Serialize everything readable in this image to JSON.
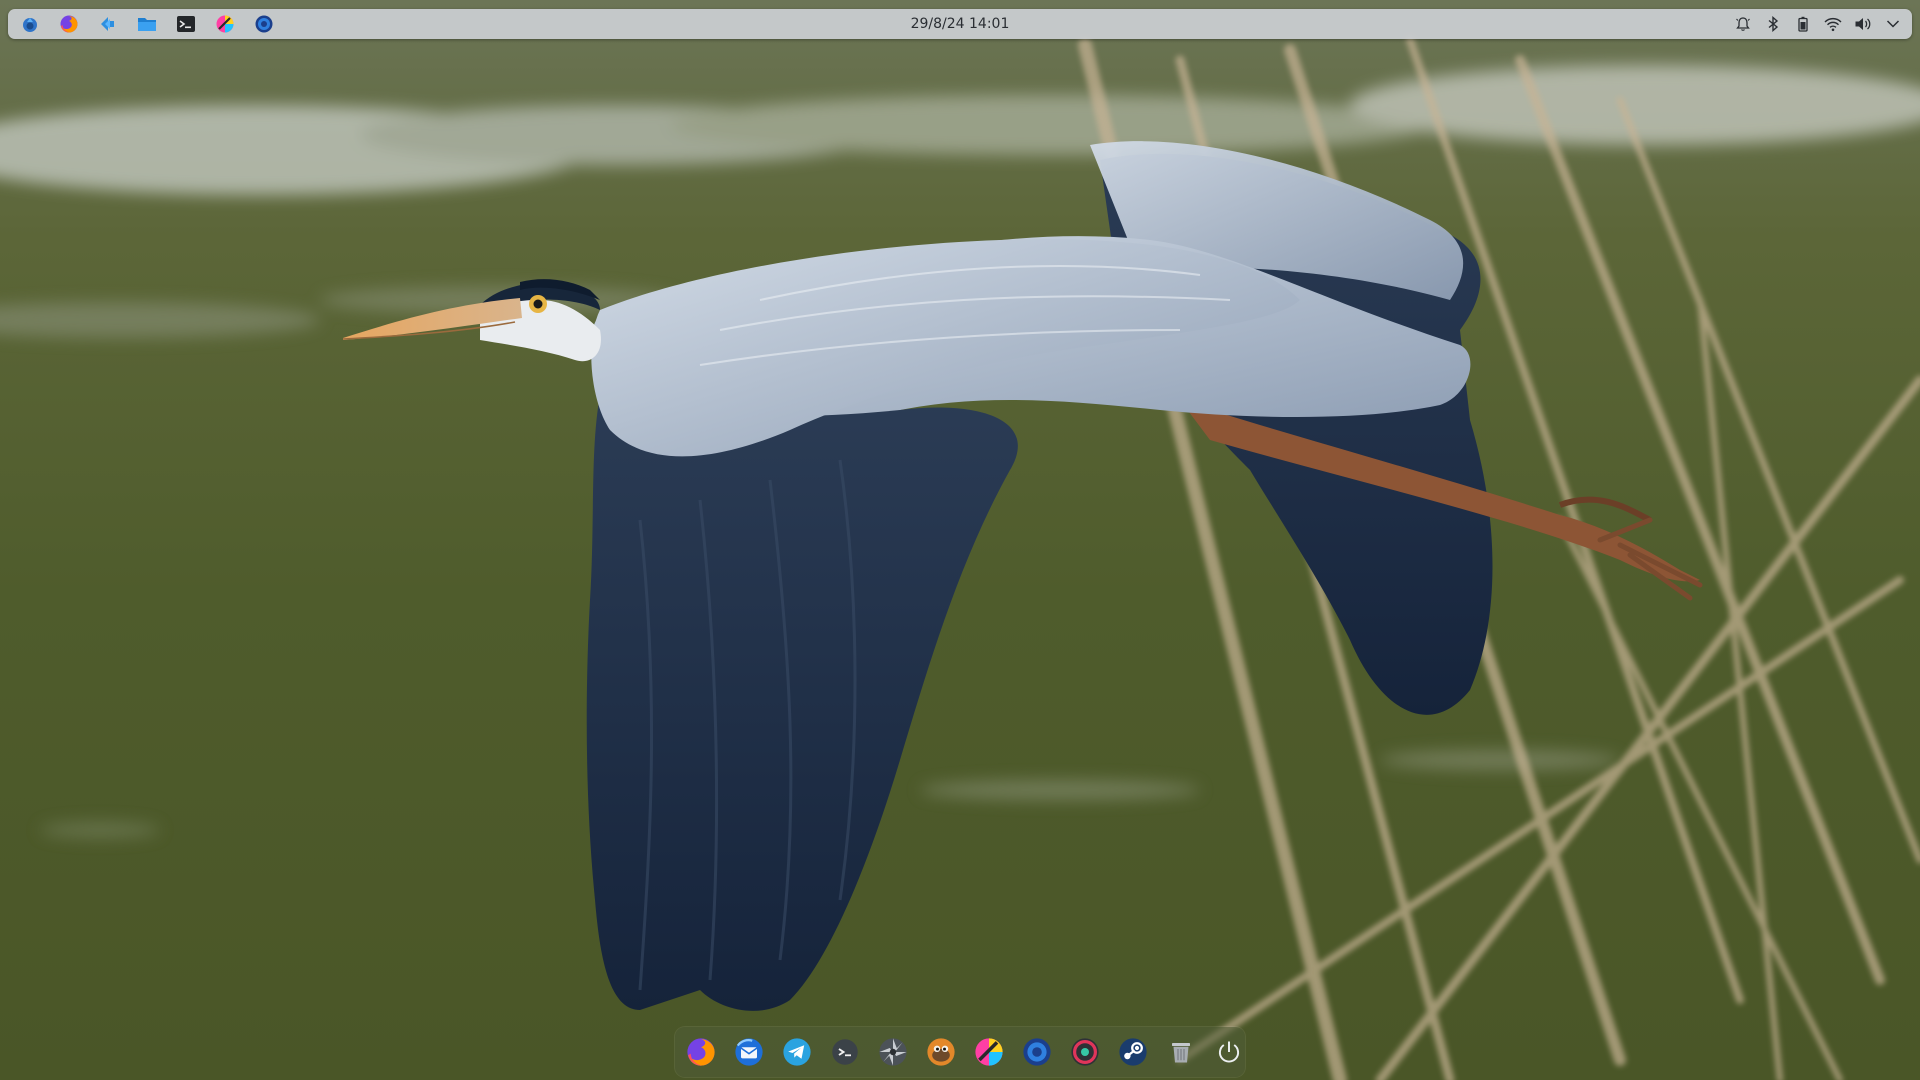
{
  "panel": {
    "clock": "29/8/24 14:01",
    "launchers": [
      {
        "name": "system-menu-icon"
      },
      {
        "name": "firefox-icon"
      },
      {
        "name": "kde-discover-icon"
      },
      {
        "name": "file-manager-icon"
      },
      {
        "name": "terminal-icon"
      },
      {
        "name": "color-app-icon"
      },
      {
        "name": "blue-circle-app-icon"
      }
    ],
    "tray": [
      {
        "name": "notifications-icon"
      },
      {
        "name": "bluetooth-icon"
      },
      {
        "name": "battery-icon"
      },
      {
        "name": "wifi-icon"
      },
      {
        "name": "volume-icon"
      },
      {
        "name": "expand-tray-chevron-icon"
      }
    ]
  },
  "dock": {
    "items": [
      {
        "name": "firefox-icon"
      },
      {
        "name": "thunderbird-icon"
      },
      {
        "name": "telegram-icon"
      },
      {
        "name": "terminal-icon"
      },
      {
        "name": "aperture-app-icon"
      },
      {
        "name": "gimp-icon"
      },
      {
        "name": "color-app-icon"
      },
      {
        "name": "blue-circle-app-icon"
      },
      {
        "name": "record-app-icon"
      },
      {
        "name": "steam-icon"
      },
      {
        "name": "trash-icon"
      },
      {
        "name": "power-icon"
      }
    ]
  },
  "colors": {
    "panel_bg": "#cbcfd2",
    "dock_bg": "#505c38",
    "water": "#4e5a2e",
    "heron_wing_dark": "#1d2d44",
    "heron_wing_light": "#a7b6c9"
  }
}
